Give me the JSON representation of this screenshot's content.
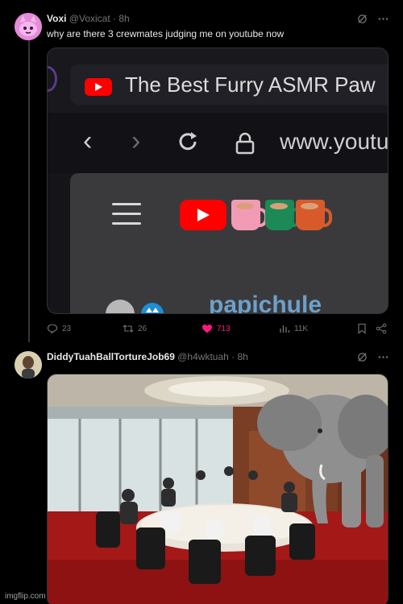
{
  "post1": {
    "display_name": "Voxi",
    "handle": "@Voxicat",
    "separator": "·",
    "time": "8h",
    "text": "why are there 3 crewmates judging me on youtube now",
    "media": {
      "tab_title": "The Best Furry ASMR Paw",
      "url": "www.youtu",
      "channel_fragment": "papichule"
    },
    "stats": {
      "replies": "23",
      "reposts": "26",
      "likes": "713",
      "views": "11K"
    }
  },
  "post2": {
    "display_name": "DiddyTuahBallTortureJob69",
    "handle": "@h4wktuah",
    "separator": "·",
    "time": "8h"
  },
  "colors": {
    "like": "#f91880",
    "muted": "#71767b",
    "yt_red": "#ff0000",
    "mug_pink": "#f29bb5",
    "mug_green": "#1b8a55",
    "mug_orange": "#d85a2a"
  },
  "icons": [
    "grok-icon",
    "more-icon",
    "reply-icon",
    "repost-icon",
    "heart-icon",
    "views-icon",
    "bookmark-icon",
    "share-icon"
  ],
  "watermark": "imgflip.com"
}
